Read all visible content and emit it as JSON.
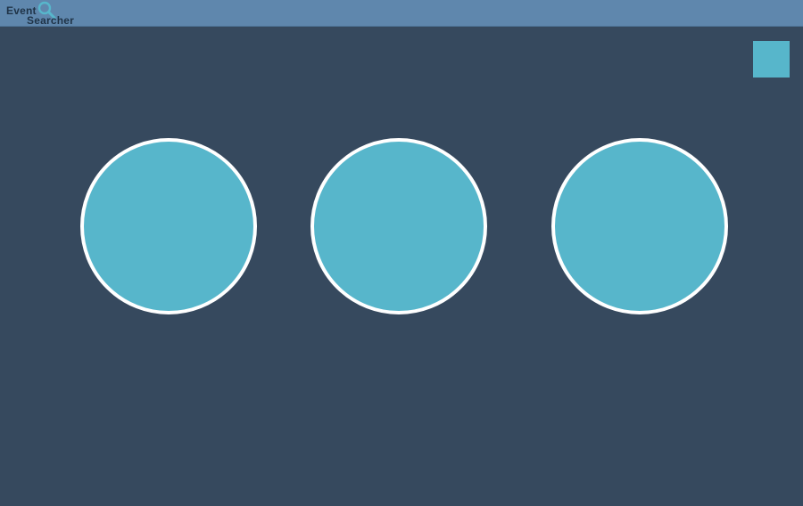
{
  "header": {
    "logo": {
      "word_1": "Event",
      "word_2": "Searcher",
      "icon": "magnifying-glass-icon"
    }
  },
  "colors": {
    "background": "#36495e",
    "header": "#5f87ad",
    "accent": "#57b6cb",
    "circle_border": "#ffffff"
  },
  "main": {
    "corner_action": {
      "icon": "square-icon"
    },
    "circles": [
      {
        "id": "circle-1"
      },
      {
        "id": "circle-2"
      },
      {
        "id": "circle-3"
      }
    ]
  }
}
